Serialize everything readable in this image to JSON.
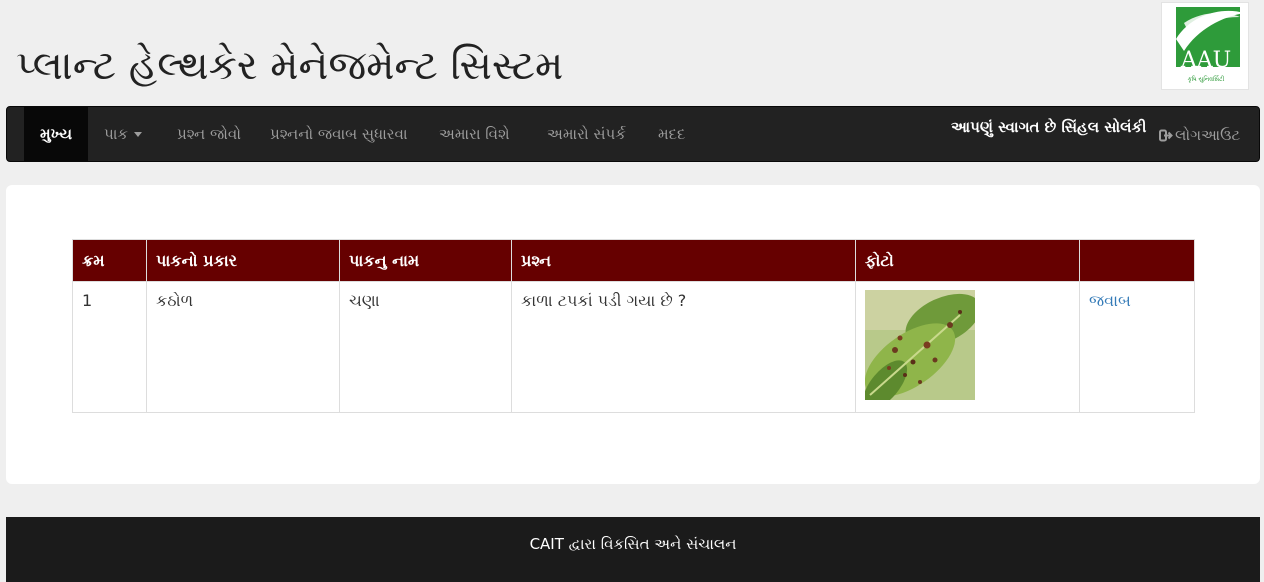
{
  "header": {
    "title": "પ્લાન્ટ હેલ્થકેર મેનેજમેન્ટ સિસ્ટમ",
    "logo_text": "AAU",
    "logo_tagline": "કૃષિ યુનિવર્સિટી"
  },
  "navbar": {
    "items": [
      {
        "label": "મુખ્ય",
        "active": true
      },
      {
        "label": "પાક",
        "has_dropdown": true
      },
      {
        "label": "પ્રશ્ન જોવો"
      },
      {
        "label": "પ્રશ્નનો જવાબ સુધારવા"
      },
      {
        "label": "અમારા વિશે"
      },
      {
        "label": "અમારો સંપર્ક"
      },
      {
        "label": "મદદ"
      }
    ],
    "welcome": "આપણું સ્વાગત છે સિંહલ સોલંકી",
    "logout": "લોગઆઉટ"
  },
  "table": {
    "headers": [
      "ક્રમ",
      "પાકનો પ્રકાર",
      "પાકનુ નામ",
      "પ્રશ્ન",
      "ફોટો",
      ""
    ],
    "rows": [
      {
        "index": "1",
        "crop_type": "કઠોળ",
        "crop_name": "ચણા",
        "question": "કાળા ટપકાં પડી ગયા છે ?",
        "photo": "diseased-leaf-photo",
        "action": "જવાબ"
      }
    ]
  },
  "footer": {
    "text": "CAIT દ્વારા વિકસિત અને સંચાલન"
  },
  "colors": {
    "navbar_bg": "#222222",
    "table_header_bg": "#660000",
    "link": "#337ab7",
    "logo_green": "#2e9b3a",
    "footer_bg": "#1b1b1b"
  }
}
